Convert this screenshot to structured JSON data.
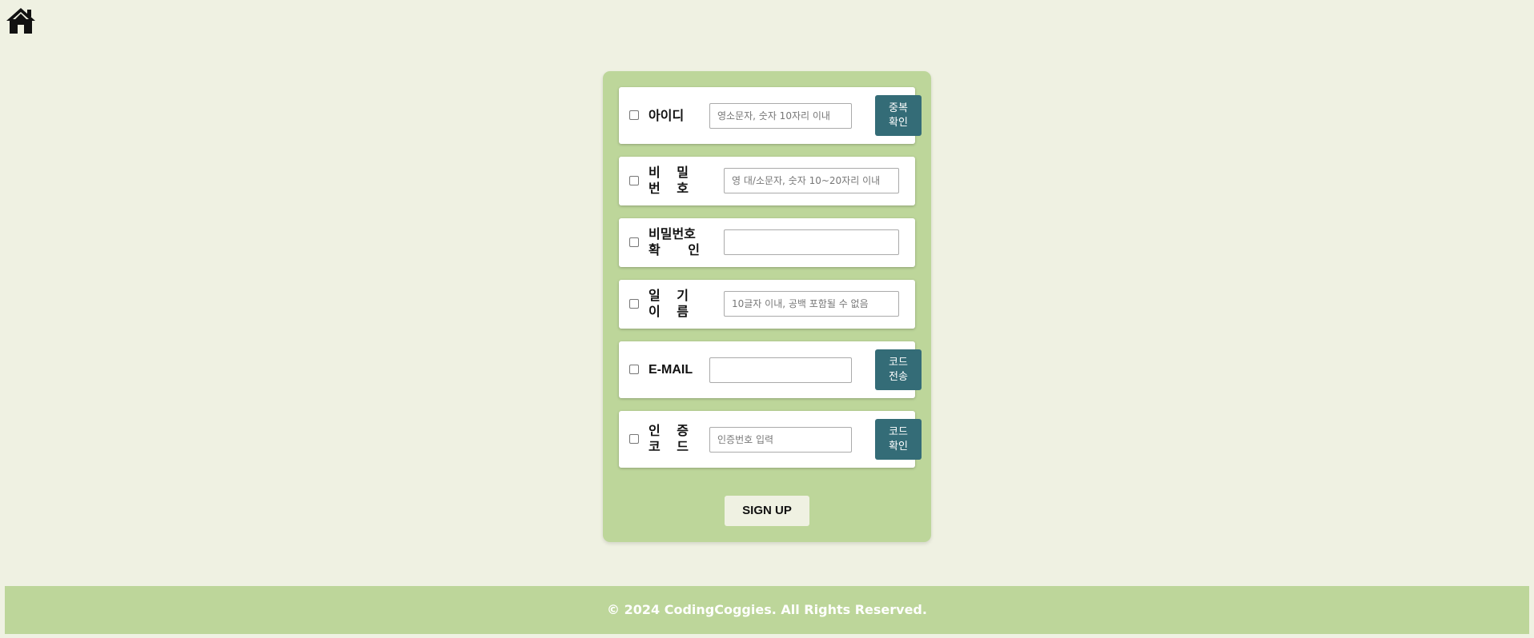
{
  "home": {
    "icon": "home-icon"
  },
  "form": {
    "id": {
      "label": "아이디",
      "placeholder": "영소문자, 숫자 10자리 이내",
      "button": "중복 확인"
    },
    "password": {
      "label_line1": [
        "비",
        "밀"
      ],
      "label_line2": [
        "번",
        "호"
      ],
      "placeholder": "영 대/소문자, 숫자 10~20자리 이내"
    },
    "password_confirm": {
      "label_line1": "비밀번호",
      "label_line2": [
        "확",
        "인"
      ],
      "placeholder": ""
    },
    "diary_name": {
      "label_line1": [
        "일",
        "기"
      ],
      "label_line2": [
        "이",
        "름"
      ],
      "placeholder": "10글자 이내, 공백 포함될 수 없음"
    },
    "email": {
      "label": "E-MAIL",
      "placeholder": "",
      "button": "코드 전송"
    },
    "auth_code": {
      "label_line1": [
        "인",
        "증"
      ],
      "label_line2": [
        "코",
        "드"
      ],
      "placeholder": "인증번호 입력",
      "button": "코드 확인"
    },
    "signup_label": "SIGN UP"
  },
  "footer": {
    "text": "© 2024 CodingCoggies. All Rights Reserved."
  }
}
